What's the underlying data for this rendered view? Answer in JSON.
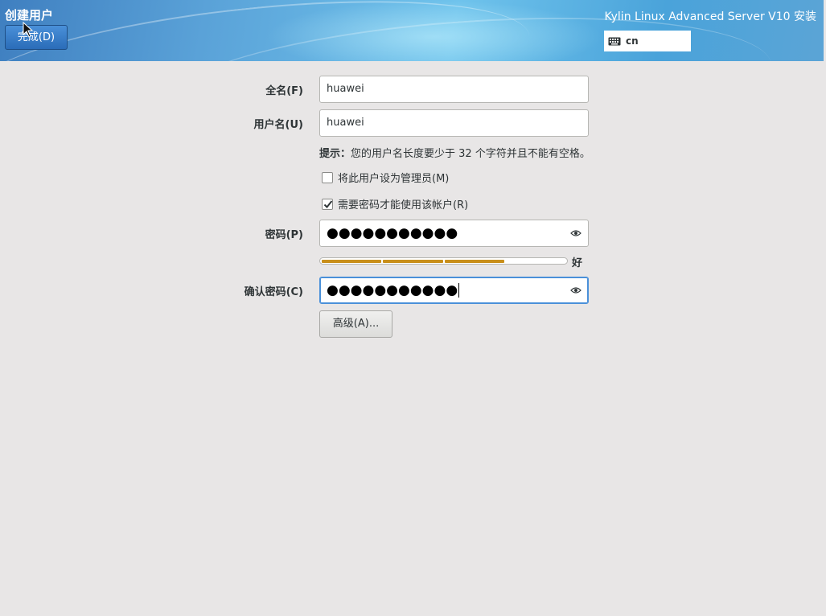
{
  "header": {
    "page_title": "创建用户",
    "done_label": "完成(D)",
    "product_title": "Kylin Linux Advanced Server V10 安装",
    "keyboard_layout": "cn"
  },
  "form": {
    "fullname_label": "全名(F)",
    "fullname_value": "huawei",
    "username_label": "用户名(U)",
    "username_value": "huawei",
    "hint_prefix": "提示：",
    "hint_text": "您的用户名长度要少于 32 个字符并且不能有空格。",
    "admin_checkbox_label": "将此用户设为管理员(M)",
    "admin_checked": false,
    "require_password_label": "需要密码才能使用该帐户(R)",
    "require_password_checked": true,
    "password_label": "密码(P)",
    "password_mask": "●●●●●●●●●●●",
    "strength_label": "好",
    "strength_level": 0.75,
    "confirm_label": "确认密码(C)",
    "confirm_mask": "●●●●●●●●●●●",
    "advanced_label": "高级(A)..."
  },
  "colors": {
    "accent": "#4a90d9",
    "strength_fill": "#c98f1a",
    "background": "#e8e6e6"
  }
}
